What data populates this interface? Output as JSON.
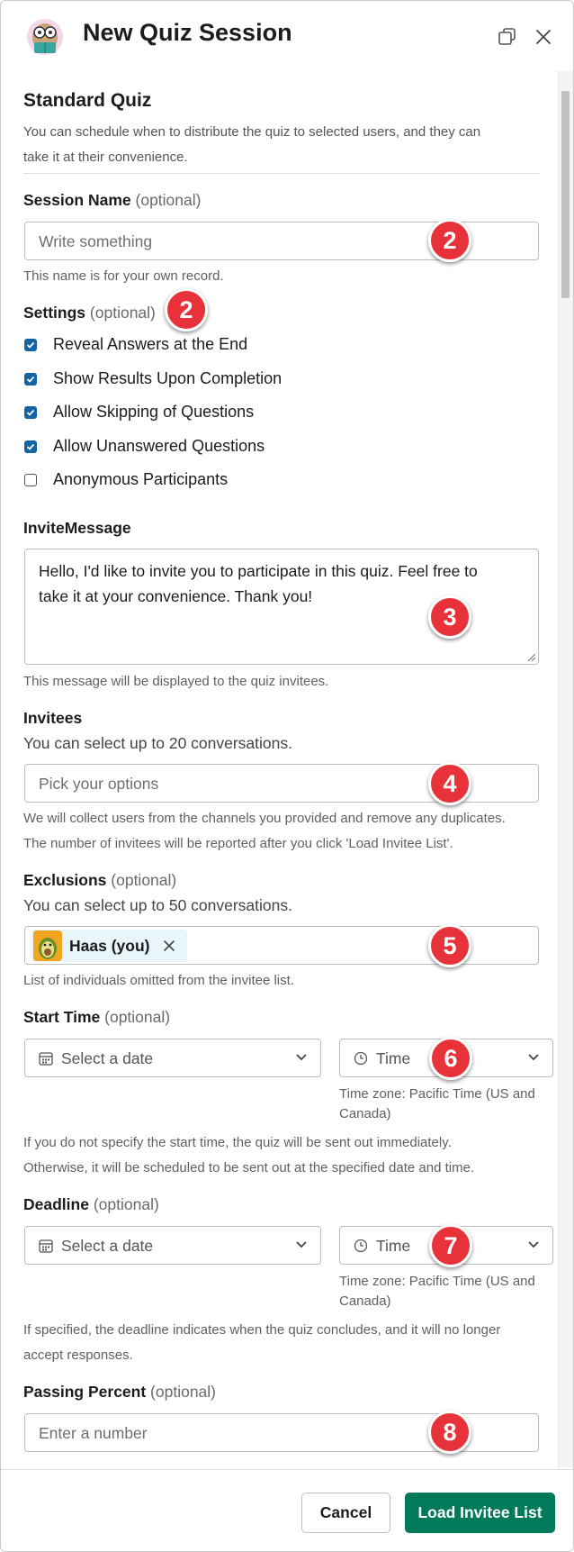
{
  "header": {
    "title": "New Quiz Session"
  },
  "section": {
    "title": "Standard Quiz",
    "description_line1": "You can schedule when to distribute the quiz to selected users, and they can",
    "description_line2": "take it at their convenience."
  },
  "session_name": {
    "label": "Session Name",
    "optional": "(optional)",
    "placeholder": "Write something",
    "hint": "This name is for your own record.",
    "badge": "2"
  },
  "settings": {
    "label": "Settings",
    "optional": "(optional)",
    "badge": "2",
    "options": [
      {
        "label": "Reveal Answers at the End",
        "checked": true
      },
      {
        "label": "Show Results Upon Completion",
        "checked": true
      },
      {
        "label": "Allow Skipping of Questions",
        "checked": true
      },
      {
        "label": "Allow Unanswered Questions",
        "checked": true
      },
      {
        "label": "Anonymous Participants",
        "checked": false
      }
    ]
  },
  "invite_message": {
    "label": "InviteMessage",
    "value": "Hello, I'd like to invite you to participate in this quiz. Feel free to take it at your convenience. Thank you!",
    "hint": "This message will be displayed to the quiz invitees.",
    "badge": "3"
  },
  "invitees": {
    "label": "Invitees",
    "sub": "You can select up to 20 conversations.",
    "placeholder": "Pick your options",
    "hint_line1": "We will collect users from the channels you provided and remove any duplicates.",
    "hint_line2": "The number of invitees will be reported after you click 'Load Invitee List'.",
    "badge": "4"
  },
  "exclusions": {
    "label": "Exclusions",
    "optional": "(optional)",
    "sub": "You can select up to 50 conversations.",
    "chip": "Haas (you)",
    "hint": "List of individuals omitted from the invitee list.",
    "badge": "5"
  },
  "start_time": {
    "label": "Start Time",
    "optional": "(optional)",
    "date_placeholder": "Select a date",
    "time_placeholder": "Time",
    "timezone_line1": "Time zone: Pacific Time (US and",
    "timezone_line2": "Canada)",
    "hint_line1": "If you do not specify the start time, the quiz will be sent out immediately.",
    "hint_line2": "Otherwise, it will be scheduled to be sent out at the specified date and time.",
    "badge": "6"
  },
  "deadline": {
    "label": "Deadline",
    "optional": "(optional)",
    "date_placeholder": "Select a date",
    "time_placeholder": "Time",
    "timezone_line1": "Time zone: Pacific Time (US and",
    "timezone_line2": "Canada)",
    "hint_line1": "If specified, the deadline indicates when the quiz concludes, and it will no longer",
    "hint_line2": "accept responses.",
    "badge": "7"
  },
  "passing_percent": {
    "label": "Passing Percent",
    "optional": "(optional)",
    "placeholder": "Enter a number",
    "badge": "8"
  },
  "footer": {
    "cancel": "Cancel",
    "submit": "Load Invitee List"
  },
  "colors": {
    "primary": "#007a5a",
    "checkbox": "#1264a3",
    "badge": "#e8323a"
  }
}
